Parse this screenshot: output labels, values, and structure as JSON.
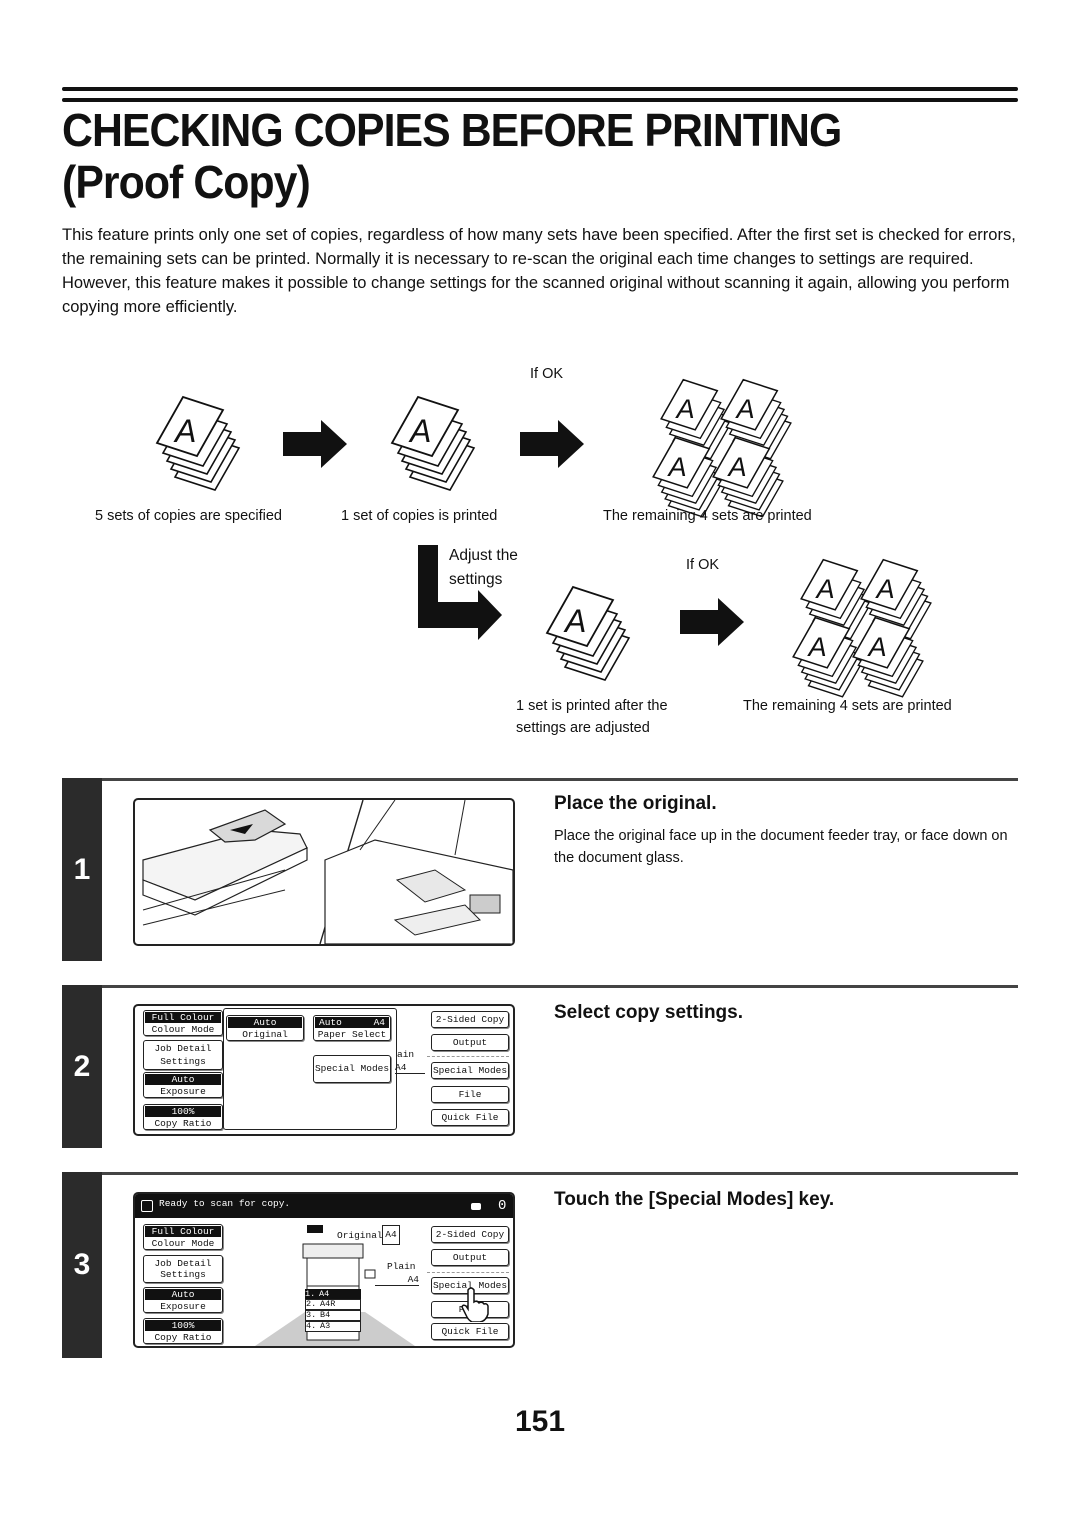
{
  "page": {
    "title_line1": "CHECKING COPIES BEFORE PRINTING",
    "title_line2": "(Proof Copy)",
    "intro": "This feature prints only one set of copies, regardless of how many sets have been specified. After the first set is checked for errors, the remaining sets can be printed. Normally it is necessary to re-scan the original each time changes to settings are required. However, this feature makes it possible to change settings for the scanned original without scanning it again, allowing you perform copying more efficiently.",
    "page_number": "151"
  },
  "diagram": {
    "if_ok_1": "If OK",
    "if_ok_2": "If OK",
    "caption_specified": "5 sets of copies are specified",
    "caption_one_printed": "1 set of copies is printed",
    "caption_remaining_1": "The remaining 4 sets are printed",
    "adjust_line1": "Adjust the",
    "adjust_line2": "settings",
    "caption_after_adjust_1": "1 set is printed after the",
    "caption_after_adjust_2": "settings are adjusted",
    "caption_remaining_2": "The remaining 4 sets are printed",
    "page_glyph": "A"
  },
  "steps": [
    {
      "number": "1",
      "title": "Place the original.",
      "description": "Place the original face up in the document feeder tray, or face down on the document glass."
    },
    {
      "number": "2",
      "title": "Select copy settings.",
      "screen": {
        "left_buttons": [
          {
            "value": "Full Colour",
            "label": "Colour Mode"
          },
          {
            "value": "Job Detail",
            "label": "Settings"
          },
          {
            "value": "Auto",
            "label": "Exposure"
          },
          {
            "value": "100%",
            "label": "Copy Ratio"
          }
        ],
        "original": {
          "value": "Auto",
          "label": "Original"
        },
        "paper": {
          "value": "Auto",
          "size": "A4",
          "label": "Paper Select"
        },
        "special_modes_popup": "Special Modes",
        "peek_text_1": "ain",
        "peek_text_2": "A4",
        "right_buttons": [
          "2-Sided Copy",
          "Output",
          "Special Modes",
          "File",
          "Quick File"
        ]
      }
    },
    {
      "number": "3",
      "title": "Touch the [Special Modes] key.",
      "screen": {
        "status": "Ready to scan for copy.",
        "count": "0",
        "left_buttons": [
          {
            "value": "Full Colour",
            "label": "Colour Mode"
          },
          {
            "value": "Job Detail",
            "label": "Settings"
          },
          {
            "value": "Auto",
            "label": "Exposure"
          },
          {
            "value": "100%",
            "label": "Copy Ratio"
          }
        ],
        "original_label": "Original",
        "original_size": "A4",
        "paper_type": "Plain",
        "paper_size": "A4",
        "trays": [
          {
            "num": "1.",
            "size": "A4"
          },
          {
            "num": "2.",
            "size": "A4R"
          },
          {
            "num": "3.",
            "size": "B4"
          },
          {
            "num": "4.",
            "size": "A3"
          }
        ],
        "right_buttons": [
          "2-Sided Copy",
          "Output",
          "Special Modes",
          "File",
          "Quick File"
        ]
      }
    }
  ]
}
